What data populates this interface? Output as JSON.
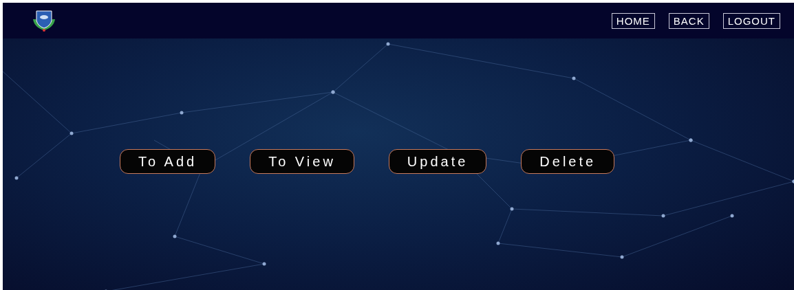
{
  "nav": {
    "links": [
      "HOME",
      "BACK",
      "LOGOUT"
    ]
  },
  "actions": [
    "To Add",
    "To View",
    "Update",
    "Delete"
  ]
}
